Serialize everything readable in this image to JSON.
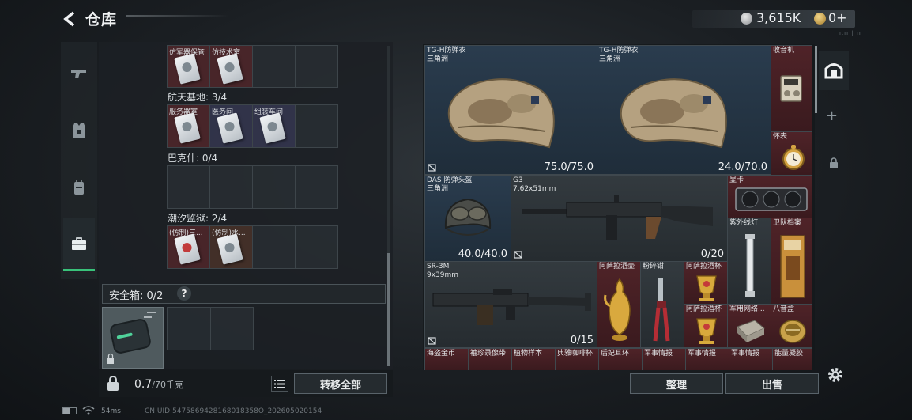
{
  "header": {
    "title": "仓库",
    "currency_silver": "3,615K",
    "currency_gold": "0+",
    "mini_text": "ı.ıı | ıı"
  },
  "inventory": {
    "row0": {
      "items": [
        "仿军器保管",
        "仿技术室"
      ]
    },
    "sections": [
      {
        "label": "航天基地: 3/4",
        "items": [
          "服务器室",
          "医务间",
          "组装车间",
          ""
        ]
      },
      {
        "label": "巴克什: 0/4",
        "items": [
          "",
          "",
          "",
          ""
        ]
      },
      {
        "label": "潮汐监狱: 2/4",
        "items": [
          "(仿制)三...",
          "(仿制)水...",
          "",
          ""
        ]
      }
    ]
  },
  "safe_box": {
    "label": "安全箱: 0/2",
    "help": "?"
  },
  "weight": {
    "value": "0.7",
    "unit": "/70千克"
  },
  "buttons": {
    "transfer_all": "转移全部",
    "sort": "整理",
    "sell": "出售"
  },
  "stash": {
    "vest1": {
      "name": "TG-H防弹衣",
      "sub": "三角洲",
      "durability": "75.0/75.0"
    },
    "vest2": {
      "name": "TG-H防弹衣",
      "sub": "三角洲",
      "durability": "24.0/70.0"
    },
    "radio": {
      "name": "收音机"
    },
    "watch": {
      "name": "怀表"
    },
    "helmet": {
      "name": "DAS 防弹头盔",
      "sub": "三角洲",
      "durability": "40.0/40.0"
    },
    "g3": {
      "name": "G3",
      "sub": "7.62x51mm",
      "ammo": "0/20"
    },
    "gpu": {
      "name": "显卡"
    },
    "uv_lamp": {
      "name": "紫外线灯"
    },
    "file": {
      "name": "卫队档案"
    },
    "sr3m": {
      "name": "SR-3M",
      "sub": "9x39mm",
      "ammo": "0/15"
    },
    "ewer": {
      "name": "阿萨拉酒壶"
    },
    "pliers": {
      "name": "粉碎钳"
    },
    "cup1": {
      "name": "阿萨拉酒杯"
    },
    "cup2": {
      "name": "阿萨拉酒杯"
    },
    "network": {
      "name": "军用网络..."
    },
    "compass": {
      "name": "八音盒"
    },
    "bottom_row": [
      "海盗金币",
      "袖珍录像带",
      "植物样本",
      "典雅咖啡杯",
      "后妃耳环",
      "军事情报",
      "军事情报",
      "军事情报",
      "能量凝胶"
    ]
  },
  "status": {
    "ping": "54ms",
    "uid": "CN UID:5475869428168018358O_202605020154"
  }
}
